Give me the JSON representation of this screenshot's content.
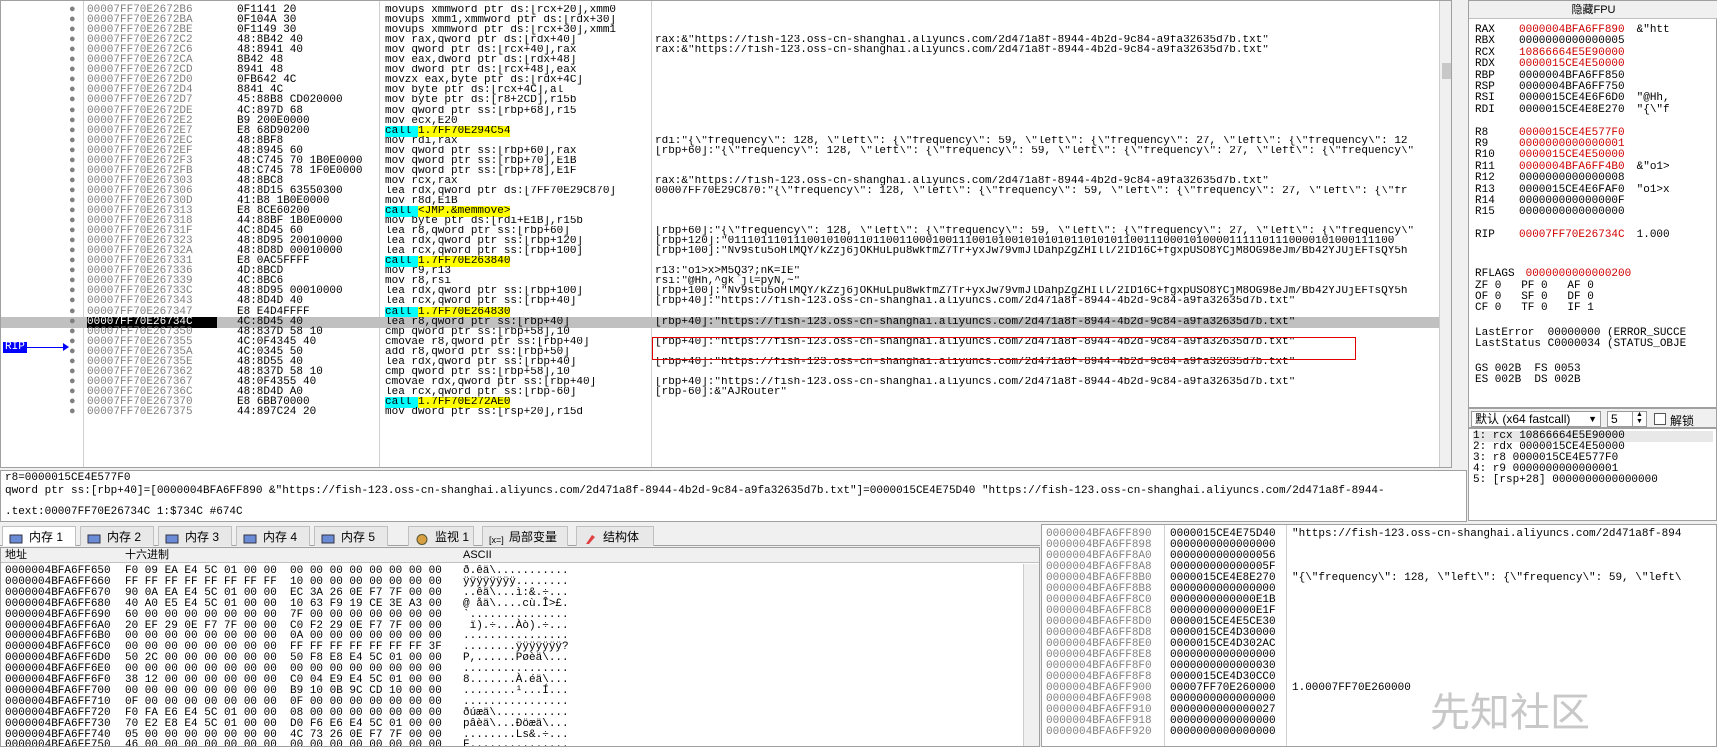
{
  "disasm": {
    "rip_label": "RIP",
    "rows": [
      {
        "addr": "00007FF70E2672B6",
        "bytes": "0F1141 20",
        "instr": "movups xmmword ptr ds:[rcx+20],xmm0",
        "cmt": ""
      },
      {
        "addr": "00007FF70E2672BA",
        "bytes": "0F104A 30",
        "instr": "movups xmm1,xmmword ptr ds:[rdx+30]",
        "cmt": ""
      },
      {
        "addr": "00007FF70E2672BE",
        "bytes": "0F1149 30",
        "instr": "movups xmmword ptr ds:[rcx+30],xmm1",
        "cmt": ""
      },
      {
        "addr": "00007FF70E2672C2",
        "bytes": "48:8B42 40",
        "instr": "mov rax,qword ptr ds:[rdx+40]",
        "cmt": "rax:&\"https://fish-123.oss-cn-shanghai.aliyuncs.com/2d471a8f-8944-4b2d-9c84-a9fa32635d7b.txt\""
      },
      {
        "addr": "00007FF70E2672C6",
        "bytes": "48:8941 40",
        "instr": "mov qword ptr ds:[rcx+40],rax",
        "cmt": "rax:&\"https://fish-123.oss-cn-shanghai.aliyuncs.com/2d471a8f-8944-4b2d-9c84-a9fa32635d7b.txt\""
      },
      {
        "addr": "00007FF70E2672CA",
        "bytes": "8B42 48",
        "instr": "mov eax,dword ptr ds:[rdx+48]",
        "cmt": ""
      },
      {
        "addr": "00007FF70E2672CD",
        "bytes": "8941 48",
        "instr": "mov dword ptr ds:[rcx+48],eax",
        "cmt": ""
      },
      {
        "addr": "00007FF70E2672D0",
        "bytes": "0FB642 4C",
        "instr": "movzx eax,byte ptr ds:[rdx+4C]",
        "cmt": ""
      },
      {
        "addr": "00007FF70E2672D4",
        "bytes": "8841 4C",
        "instr": "mov byte ptr ds:[rcx+4C],al",
        "cmt": ""
      },
      {
        "addr": "00007FF70E2672D7",
        "bytes": "45:88B8 CD020000",
        "instr": "mov byte ptr ds:[r8+2CD],r15b",
        "cmt": ""
      },
      {
        "addr": "00007FF70E2672DE",
        "bytes": "4C:897D 68",
        "instr": "mov qword ptr ss:[rbp+68],r15",
        "cmt": ""
      },
      {
        "addr": "00007FF70E2672E2",
        "bytes": "B9 200E0000",
        "instr": "mov ecx,E20",
        "cmt": ""
      },
      {
        "addr": "00007FF70E2672E7",
        "bytes": "E8 68D90200",
        "instr": "call 1.7FF70E294C54",
        "cmt": "",
        "call": true
      },
      {
        "addr": "00007FF70E2672EC",
        "bytes": "48:8BF8",
        "instr": "mov rdi,rax",
        "cmt": "rdi:\"{\\\"frequency\\\": 128, \\\"left\\\": {\\\"frequency\\\": 59, \\\"left\\\": {\\\"frequency\\\": 27, \\\"left\\\": {\\\"frequency\\\": 12"
      },
      {
        "addr": "00007FF70E2672EF",
        "bytes": "48:8945 60",
        "instr": "mov qword ptr ss:[rbp+60],rax",
        "cmt": "[rbp+60]:\"{\\\"frequency\\\": 128, \\\"left\\\": {\\\"frequency\\\": 59, \\\"left\\\": {\\\"frequency\\\": 27, \\\"left\\\": {\\\"frequency\\\""
      },
      {
        "addr": "00007FF70E2672F3",
        "bytes": "48:C745 70 1B0E0000",
        "instr": "mov qword ptr ss:[rbp+70],E1B",
        "cmt": ""
      },
      {
        "addr": "00007FF70E2672FB",
        "bytes": "48:C745 78 1F0E0000",
        "instr": "mov qword ptr ss:[rbp+78],E1F",
        "cmt": ""
      },
      {
        "addr": "00007FF70E267303",
        "bytes": "48:8BC8",
        "instr": "mov rcx,rax",
        "cmt": "rax:&\"https://fish-123.oss-cn-shanghai.aliyuncs.com/2d471a8f-8944-4b2d-9c84-a9fa32635d7b.txt\""
      },
      {
        "addr": "00007FF70E267306",
        "bytes": "48:8D15 63550300",
        "instr": "lea rdx,qword ptr ds:[7FF70E29C870]",
        "cmt": "00007FF70E29C870:\"{\\\"frequency\\\": 128, \\\"left\\\": {\\\"frequency\\\": 59, \\\"left\\\": {\\\"frequency\\\": 27, \\\"left\\\": {\\\"fr",
        "lea": true
      },
      {
        "addr": "00007FF70E26730D",
        "bytes": "41:B8 1B0E0000",
        "instr": "mov r8d,E1B",
        "cmt": ""
      },
      {
        "addr": "00007FF70E267313",
        "bytes": "E8 8CE60200",
        "instr": "call <JMP.&memmove>",
        "cmt": "",
        "call": true,
        "jmp": true
      },
      {
        "addr": "00007FF70E267318",
        "bytes": "44:88BF 1B0E0000",
        "instr": "mov byte ptr ds:[rdi+E1B],r15b",
        "cmt": ""
      },
      {
        "addr": "00007FF70E26731F",
        "bytes": "4C:8D45 60",
        "instr": "lea r8,qword ptr ss:[rbp+60]",
        "cmt": "[rbp+60]:\"{\\\"frequency\\\": 128, \\\"left\\\": {\\\"frequency\\\": 59, \\\"left\\\": {\\\"frequency\\\": 27, \\\"left\\\": {\\\"frequency\\\""
      },
      {
        "addr": "00007FF70E267323",
        "bytes": "48:8D95 20010000",
        "instr": "lea rdx,qword ptr ss:[rbp+120]",
        "cmt": "[rbp+120]:\"01110111011100101001101100110001001110010100101010101101010110011100010100001111101110000101000111100"
      },
      {
        "addr": "00007FF70E26732A",
        "bytes": "48:8D8D 00010000",
        "instr": "lea rcx,qword ptr ss:[rbp+100]",
        "cmt": "[rbp+100]:\"Nv9stu5oHlMQY/kZzj6jOKHuLpu8wkfmZ7Tr+yxJw79vmJlDahpZgZHIll/2ID16C+fgxpUSO8YCjM8OG98eJm/Bb42YJUjEFTsQY5h"
      },
      {
        "addr": "00007FF70E267331",
        "bytes": "E8 0AC5FFFF",
        "instr": "call 1.7FF70E263840",
        "cmt": "",
        "call": true
      },
      {
        "addr": "00007FF70E267336",
        "bytes": "4D:8BCD",
        "instr": "mov r9,r13",
        "cmt": "r13:\"o1>x>M5Q3?;nK=IE\""
      },
      {
        "addr": "00007FF70E267339",
        "bytes": "4C:8BC6",
        "instr": "mov r8,rsi",
        "cmt": "rsi:\"@Hh,^gk`jl=pyN,~\""
      },
      {
        "addr": "00007FF70E26733C",
        "bytes": "48:8D95 00010000",
        "instr": "lea rdx,qword ptr ss:[rbp+100]",
        "cmt": "[rbp+100]:\"Nv9stu5oHlMQY/kZzj6jOKHuLpu8wkfmZ7Tr+yxJw79vmJlDahpZgZHIll/2ID16C+fgxpUSO8YCjM8OG98eJm/Bb42YJUjEFTsQY5h"
      },
      {
        "addr": "00007FF70E267343",
        "bytes": "48:8D4D 40",
        "instr": "lea rcx,qword ptr ss:[rbp+40]",
        "cmt": "[rbp+40]:\"https://fish-123.oss-cn-shanghai.aliyuncs.com/2d471a8f-8944-4b2d-9c84-a9fa32635d7b.txt\""
      },
      {
        "addr": "00007FF70E267347",
        "bytes": "E8 E4D4FFFF",
        "instr": "call 1.7FF70E264830",
        "cmt": "",
        "call": true
      },
      {
        "addr": "00007FF70E26734C",
        "bytes": "4C:8D45 40",
        "instr": "lea r8,qword ptr ss:[rbp+40]",
        "cmt": "[rbp+40]:\"https://fish-123.oss-cn-shanghai.aliyuncs.com/2d471a8f-8944-4b2d-9c84-a9fa32635d7b.txt\"",
        "current": true
      },
      {
        "addr": "00007FF70E267350",
        "bytes": "48:837D 58 10",
        "instr": "cmp qword ptr ss:[rbp+58],10",
        "cmt": ""
      },
      {
        "addr": "00007FF70E267355",
        "bytes": "4C:0F4345 40",
        "instr": "cmovae r8,qword ptr ss:[rbp+40]",
        "cmt": "[rbp+40]:\"https://fish-123.oss-cn-shanghai.aliyuncs.com/2d471a8f-8944-4b2d-9c84-a9fa32635d7b.txt\""
      },
      {
        "addr": "00007FF70E26735A",
        "bytes": "4C:0345 50",
        "instr": "add r8,qword ptr ss:[rbp+50]",
        "cmt": ""
      },
      {
        "addr": "00007FF70E26735E",
        "bytes": "48:8D55 40",
        "instr": "lea rdx,qword ptr ss:[rbp+40]",
        "cmt": "[rbp+40]:\"https://fish-123.oss-cn-shanghai.aliyuncs.com/2d471a8f-8944-4b2d-9c84-a9fa32635d7b.txt\""
      },
      {
        "addr": "00007FF70E267362",
        "bytes": "48:837D 58 10",
        "instr": "cmp qword ptr ss:[rbp+58],10",
        "cmt": ""
      },
      {
        "addr": "00007FF70E267367",
        "bytes": "48:0F4355 40",
        "instr": "cmovae rdx,qword ptr ss:[rbp+40]",
        "cmt": "[rbp+40]:\"https://fish-123.oss-cn-shanghai.aliyuncs.com/2d471a8f-8944-4b2d-9c84-a9fa32635d7b.txt\""
      },
      {
        "addr": "00007FF70E26736C",
        "bytes": "48:8D4D A0",
        "instr": "lea rcx,qword ptr ss:[rbp-60]",
        "cmt": "[rbp-60]:&\"AJRouter\""
      },
      {
        "addr": "00007FF70E267370",
        "bytes": "E8 6BB70000",
        "instr": "call 1.7FF70E272AE0",
        "cmt": "",
        "call": true
      },
      {
        "addr": "00007FF70E267375",
        "bytes": "44:897C24 20",
        "instr": "mov dword ptr ss:[rsp+20],r15d",
        "cmt": ""
      }
    ]
  },
  "info": {
    "line1": "r8=0000015CE4E577F0",
    "line2": "qword ptr ss:[rbp+40]=[0000004BFA6FF890 &\"https://fish-123.oss-cn-shanghai.aliyuncs.com/2d471a8f-8944-4b2d-9c84-a9fa32635d7b.txt\"]=0000015CE4E75D40 \"https://fish-123.oss-cn-shanghai.aliyuncs.com/2d471a8f-8944-",
    "line3": ".text:00007FF70E26734C 1:$734C #674C"
  },
  "registers": {
    "title": "隐藏FPU",
    "regs": [
      {
        "n": "RAX",
        "v": "0000004BFA6FF890",
        "i": "&\"htt",
        "red": true
      },
      {
        "n": "RBX",
        "v": "0000000000000005",
        "i": "",
        "red": false
      },
      {
        "n": "RCX",
        "v": "10866664E5E90000",
        "i": "",
        "red": true
      },
      {
        "n": "RDX",
        "v": "0000015CE4E50000",
        "i": "",
        "red": true
      },
      {
        "n": "RBP",
        "v": "0000004BFA6FF850",
        "i": "",
        "red": false
      },
      {
        "n": "RSP",
        "v": "0000004BFA6FF750",
        "i": "",
        "red": false
      },
      {
        "n": "RSI",
        "v": "0000015CE4E6F6D0",
        "i": "\"@Hh,",
        "red": false
      },
      {
        "n": "RDI",
        "v": "0000015CE4E8E270",
        "i": "\"{\\\"f",
        "red": false
      },
      {
        "n": "",
        "v": "",
        "i": "",
        "red": false
      },
      {
        "n": "R8",
        "v": "0000015CE4E577F0",
        "i": "",
        "red": true
      },
      {
        "n": "R9",
        "v": "0000000000000001",
        "i": "",
        "red": true
      },
      {
        "n": "R10",
        "v": "0000015CE4E50000",
        "i": "",
        "red": true
      },
      {
        "n": "R11",
        "v": "0000004BFA6FF4B0",
        "i": "&\"o1>",
        "red": true
      },
      {
        "n": "R12",
        "v": "0000000000000008",
        "i": "",
        "red": false
      },
      {
        "n": "R13",
        "v": "0000015CE4E6FAF0",
        "i": "\"o1>x",
        "red": false
      },
      {
        "n": "R14",
        "v": "000000000000000F",
        "i": "",
        "red": false
      },
      {
        "n": "R15",
        "v": "0000000000000000",
        "i": "",
        "red": false
      },
      {
        "n": "",
        "v": "",
        "i": "",
        "red": false
      },
      {
        "n": "RIP",
        "v": "00007FF70E26734C",
        "i": "1.000",
        "red": true
      }
    ],
    "rflags_label": "RFLAGS",
    "rflags_value": "0000000000000200",
    "flags1": "ZF 0   PF 0   AF 0",
    "flags2": "OF 0   SF 0   DF 0",
    "flags3": "CF 0   TF 0   IF 1",
    "lasterror": "LastError  00000000 (ERROR_SUCCE",
    "laststatus": "LastStatus C0000034 (STATUS_OBJE",
    "seg1": "GS 002B  FS 0053",
    "seg2": "ES 002B  DS 002B"
  },
  "callconv": {
    "selected": "默认 (x64 fastcall)",
    "count": "5",
    "lock_label": "解锁"
  },
  "args": [
    "1: rcx 10866664E5E90000",
    "2: rdx 0000015CE4E50000",
    "3: r8 0000015CE4E577F0",
    "4: r9 0000000000000001",
    "5: [rsp+28] 0000000000000000"
  ],
  "tabs": [
    "内存 1",
    "内存 2",
    "内存 3",
    "内存 4",
    "内存 5",
    "监视 1",
    "局部变量",
    "结构体"
  ],
  "dump": {
    "hdr_addr": "地址",
    "hdr_hex": "十六进制",
    "hdr_ascii": "ASCII",
    "rows": [
      {
        "a": "0000004BFA6FF650",
        "h": "F0 09 EA E4 5C 01 00 00  00 00 00 00 00 00 00 00",
        "s": "ð.êä\\..........."
      },
      {
        "a": "0000004BFA6FF660",
        "h": "FF FF FF FF FF FF FF FF  10 00 00 00 00 00 00 00",
        "s": "ÿÿÿÿÿÿÿÿ........"
      },
      {
        "a": "0000004BFA6FF670",
        "h": "90 0A EA E4 5C 01 00 00  EC 3A 26 0E F7 7F 00 00",
        "s": "..êä\\...ì:&.÷..."
      },
      {
        "a": "0000004BFA6FF680",
        "h": "40 A0 E5 E4 5C 01 00 00  10 63 F9 19 CE 3E A3 00",
        "s": "@ åä\\....cù.Î>£."
      },
      {
        "a": "0000004BFA6FF690",
        "h": "60 00 00 00 00 00 00 00  7F 00 00 00 00 00 00 00",
        "s": "`..............."
      },
      {
        "a": "0000004BFA6FF6A0",
        "h": "20 EF 29 0E F7 7F 00 00  C0 F2 29 0E F7 7F 00 00",
        "s": " ï).÷...Àò).÷..."
      },
      {
        "a": "0000004BFA6FF6B0",
        "h": "00 00 00 00 00 00 00 00  0A 00 00 00 00 00 00 00",
        "s": "................"
      },
      {
        "a": "0000004BFA6FF6C0",
        "h": "00 00 00 00 00 00 00 00  FF FF FF FF FF FF FF 3F",
        "s": "........ÿÿÿÿÿÿÿ?"
      },
      {
        "a": "0000004BFA6FF6D0",
        "h": "50 2C 00 00 00 00 00 00  50 F8 E8 E4 5C 01 00 00",
        "s": "P,......Pøèä\\..."
      },
      {
        "a": "0000004BFA6FF6E0",
        "h": "00 00 00 00 00 00 00 00  00 00 00 00 00 00 00 00",
        "s": "................"
      },
      {
        "a": "0000004BFA6FF6F0",
        "h": "38 12 00 00 00 00 00 00  C0 04 E9 E4 5C 01 00 00",
        "s": "8.......À.éä\\..."
      },
      {
        "a": "0000004BFA6FF700",
        "h": "00 00 00 00 00 00 00 00  B9 10 0B 9C CD 10 00 00",
        "s": "........¹...Í..."
      },
      {
        "a": "0000004BFA6FF710",
        "h": "0F 00 00 00 00 00 00 00  0F 00 00 00 00 00 00 00",
        "s": "................"
      },
      {
        "a": "0000004BFA6FF720",
        "h": "F0 FA E6 E4 5C 01 00 00  08 00 00 00 00 00 00 00",
        "s": "ðúæä\\..........."
      },
      {
        "a": "0000004BFA6FF730",
        "h": "70 E2 E8 E4 5C 01 00 00  D0 F6 E6 E4 5C 01 00 00",
        "s": "pâèä\\...Ðöæä\\..."
      },
      {
        "a": "0000004BFA6FF740",
        "h": "05 00 00 00 00 00 00 00  4C 73 26 0E F7 7F 00 00",
        "s": "........Ls&.÷..."
      },
      {
        "a": "0000004BFA6FF750",
        "h": "46 00 00 00 00 00 00 00  00 00 00 00 00 00 00 00",
        "s": "F..............."
      }
    ]
  },
  "stack": {
    "rows": [
      {
        "a": "0000004BFA6FF890",
        "v": "0000015CE4E75D40",
        "c": "\"https://fish-123.oss-cn-shanghai.aliyuncs.com/2d471a8f-894"
      },
      {
        "a": "0000004BFA6FF898",
        "v": "0000000000000000",
        "c": ""
      },
      {
        "a": "0000004BFA6FF8A0",
        "v": "0000000000000056",
        "c": ""
      },
      {
        "a": "0000004BFA6FF8A8",
        "v": "000000000000005F",
        "c": ""
      },
      {
        "a": "0000004BFA6FF8B0",
        "v": "0000015CE4E8E270",
        "c": "\"{\\\"frequency\\\": 128, \\\"left\\\": {\\\"frequency\\\": 59, \\\"left\\"
      },
      {
        "a": "0000004BFA6FF8B8",
        "v": "0000000000000000",
        "c": ""
      },
      {
        "a": "0000004BFA6FF8C0",
        "v": "0000000000000E1B",
        "c": ""
      },
      {
        "a": "0000004BFA6FF8C8",
        "v": "0000000000000E1F",
        "c": ""
      },
      {
        "a": "0000004BFA6FF8D0",
        "v": "0000015CE4E5CE30",
        "c": ""
      },
      {
        "a": "0000004BFA6FF8D8",
        "v": "0000015CE4D30000",
        "c": ""
      },
      {
        "a": "0000004BFA6FF8E0",
        "v": "0000015CE4D302AC",
        "c": ""
      },
      {
        "a": "0000004BFA6FF8E8",
        "v": "0000000000000000",
        "c": ""
      },
      {
        "a": "0000004BFA6FF8F0",
        "v": "0000000000000030",
        "c": ""
      },
      {
        "a": "0000004BFA6FF8F8",
        "v": "0000015CE4D30CC0",
        "c": ""
      },
      {
        "a": "0000004BFA6FF900",
        "v": "00007FF70E260000",
        "c": "1.00007FF70E260000"
      },
      {
        "a": "0000004BFA6FF908",
        "v": "0000000000000000",
        "c": ""
      },
      {
        "a": "0000004BFA6FF910",
        "v": "0000000000000027",
        "c": ""
      },
      {
        "a": "0000004BFA6FF918",
        "v": "0000000000000000",
        "c": ""
      },
      {
        "a": "0000004BFA6FF920",
        "v": "0000000000000000",
        "c": ""
      }
    ]
  },
  "watermark": "先知社区"
}
